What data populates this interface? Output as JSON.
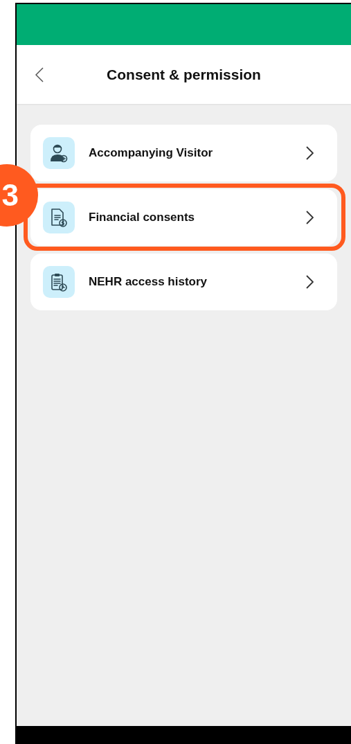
{
  "header": {
    "title": "Consent & permission"
  },
  "items": [
    {
      "label": "Accompanying Visitor",
      "kind": "visitor",
      "highlighted": false
    },
    {
      "label": "Financial consents",
      "kind": "finance",
      "highlighted": true
    },
    {
      "label": "NEHR access history",
      "kind": "history",
      "highlighted": false
    }
  ],
  "step_badge": "3"
}
